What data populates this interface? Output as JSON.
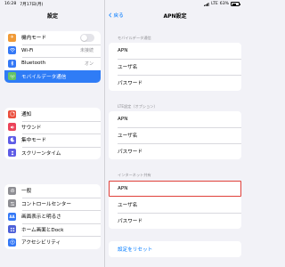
{
  "status_bar": {
    "time": "16:28",
    "date": "7月17日(月)",
    "signal": "LTE",
    "battery": "63%"
  },
  "left": {
    "title": "設定",
    "group1": [
      {
        "label": "機内モード",
        "icon": "airplane-icon",
        "color": "#f09a37"
      },
      {
        "label": "Wi-Fi",
        "icon": "wifi-icon",
        "color": "#3478f6",
        "value": "未接続"
      },
      {
        "label": "Bluetooth",
        "icon": "bluetooth-icon",
        "color": "#3478f6",
        "value": "オン"
      },
      {
        "label": "モバイルデータ通信",
        "icon": "antenna-icon",
        "color": "#65c466"
      }
    ],
    "group2": [
      {
        "label": "通知",
        "icon": "bell-icon",
        "color": "#eb4e3d"
      },
      {
        "label": "サウンド",
        "icon": "speaker-icon",
        "color": "#eb445a"
      },
      {
        "label": "集中モード",
        "icon": "moon-icon",
        "color": "#5e5ce6"
      },
      {
        "label": "スクリーンタイム",
        "icon": "hourglass-icon",
        "color": "#5e5ce6"
      }
    ],
    "group3": [
      {
        "label": "一般",
        "icon": "gear-icon",
        "color": "#8e8e93"
      },
      {
        "label": "コントロールセンター",
        "icon": "sliders-icon",
        "color": "#8e8e93"
      },
      {
        "label": "画面表示と明るさ",
        "icon": "text-size-icon",
        "color": "#3478f6",
        "glyph": "AA"
      },
      {
        "label": "ホーム画面とDock",
        "icon": "grid-icon",
        "color": "#4c5fd8"
      },
      {
        "label": "アクセシビリティ",
        "icon": "accessibility-icon",
        "color": "#3478f6"
      }
    ]
  },
  "right": {
    "back_label": "戻る",
    "title": "APN設定",
    "section1_label": "モバイルデータ通信",
    "section1": [
      "APN",
      "ユーザ名",
      "パスワード"
    ],
    "section2_label": "LTE設定（オプション）",
    "section2": [
      "APN",
      "ユーザ名",
      "パスワード"
    ],
    "section3_label": "インターネット共有",
    "section3": [
      "APN",
      "ユーザ名",
      "パスワード"
    ],
    "reset_label": "設定をリセット"
  },
  "colors": {
    "accent": "#007aff",
    "selected_row": "#2f7cf6",
    "highlight_border": "#e0403a"
  }
}
